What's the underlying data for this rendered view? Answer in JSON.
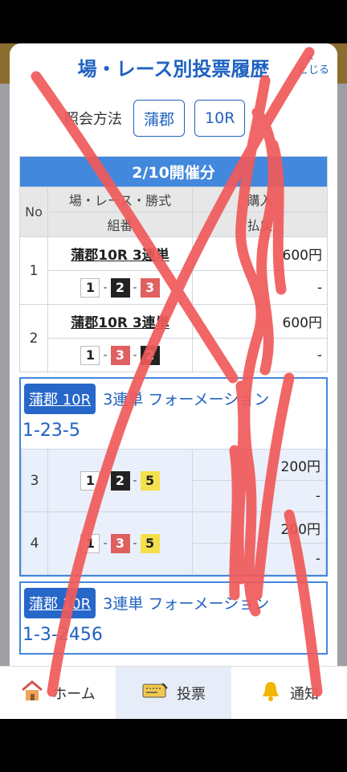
{
  "modal": {
    "title": "場・レース別投票履歴",
    "close_label": "とじる",
    "close_icon": "close-icon"
  },
  "query": {
    "label": "照会方法",
    "venue": "蒲郡",
    "race": "10R"
  },
  "history": {
    "date_header": "2/10開催分",
    "col_no": "No",
    "col_race_top": "場・レース・勝式",
    "col_race_bottom": "組番",
    "col_amt_top": "購入",
    "col_amt_bottom": "払戻",
    "rows": [
      {
        "no": "1",
        "race": "蒲郡10R 3連単",
        "combo": [
          "1",
          "2",
          "3"
        ],
        "amount": "600円",
        "payout": "-"
      },
      {
        "no": "2",
        "race": "蒲郡10R 3連単",
        "combo": [
          "1",
          "3",
          "2"
        ],
        "amount": "600円",
        "payout": "-"
      }
    ]
  },
  "formations": [
    {
      "badge": "蒲郡 10R",
      "type": "3連単 フォーメーション",
      "combo": "1-23-5",
      "rows": [
        {
          "no": "3",
          "combo": [
            "1",
            "2",
            "5"
          ],
          "amount": "200円",
          "payout": "-"
        },
        {
          "no": "4",
          "combo": [
            "1",
            "3",
            "5"
          ],
          "amount": "200円",
          "payout": "-"
        }
      ]
    },
    {
      "badge": "蒲郡 10R",
      "type": "3連単 フォーメーション",
      "combo": "1-3-2456"
    }
  ],
  "footer": {
    "tabs": [
      {
        "label": "ホーム",
        "icon": "home-icon"
      },
      {
        "label": "投票",
        "icon": "ticket-icon"
      },
      {
        "label": "通知",
        "icon": "bell-icon"
      }
    ]
  },
  "colors": {
    "accent": "#1f62c1",
    "header_blue": "#4288dd",
    "annotation_red": "#f05a5a"
  }
}
